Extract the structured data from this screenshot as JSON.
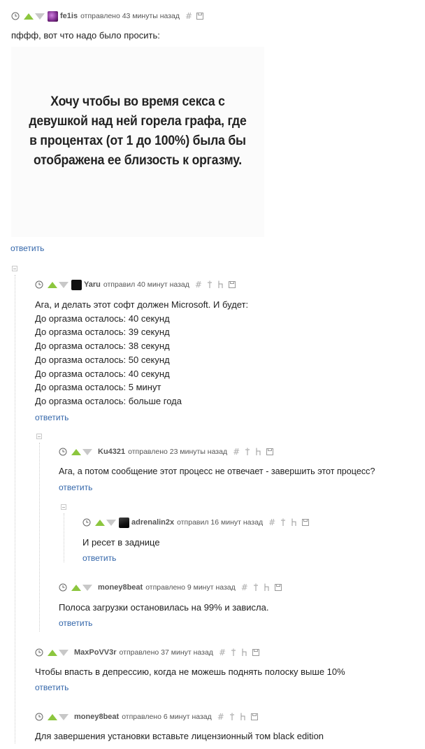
{
  "comments": [
    {
      "nick": "fe1is",
      "sent": "отправлено 43 минуты назад",
      "text": [
        "пффф, вот что надо было просить:"
      ],
      "image_text": [
        "Хочу чтобы во время секса с",
        "девушкой над ней горела графа, где",
        "в процентах (от 1 до 100%) была бы",
        "отображена ее близость к оргазму."
      ],
      "reply_label": "ответить"
    },
    {
      "nick": "Yaru",
      "sent": "отправил 40 минут назад",
      "text": [
        "Ага, и делать этот софт должен Microsoft. И будет:",
        "До оргазма осталось: 40 секунд",
        "До оргазма осталось: 39 секунд",
        "До оргазма осталось: 38 секунд",
        "До оргазма осталось: 50 секунд",
        "До оргазма осталось: 40 секунд",
        "До оргазма осталось: 5 минут",
        "До оргазма осталось: больше года"
      ],
      "reply_label": "ответить"
    },
    {
      "nick": "Ku4321",
      "sent": "отправлено 23 минуты назад",
      "text": [
        "Ага, а потом сообщение этот процесс не отвечает - завершить этот процесс?"
      ],
      "reply_label": "ответить"
    },
    {
      "nick": "adrenalin2x",
      "sent": "отправил 16 минут назад",
      "text": [
        "И ресет в заднице"
      ],
      "reply_label": "ответить"
    },
    {
      "nick": "money8beat",
      "sent": "отправлено 9 минут назад",
      "text": [
        "Полоса загрузки остановилась на 99% и зависла."
      ],
      "reply_label": "ответить"
    },
    {
      "nick": "MaxPoVV3r",
      "sent": "отправлено 37 минут назад",
      "text": [
        "Чтобы впасть в депрессию, когда не можешь поднять полоску выше 10%"
      ],
      "reply_label": "ответить"
    },
    {
      "nick": "money8beat",
      "sent": "отправлено 6 минут назад",
      "text": [
        "Для завершения установки вставьте лицензионный том black edition"
      ]
    }
  ],
  "icons": {
    "clock": "clock-icon",
    "upvote": "upvote-arrow-icon",
    "downvote": "downvote-arrow-icon",
    "hash": "#",
    "save": "save-icon",
    "parent": "parent-comment-icon",
    "thread": "thread-icon"
  },
  "colors": {
    "upvote": "#8cc63e",
    "downvote": "#c8c8c8",
    "link": "#3366aa",
    "meta": "#555555"
  }
}
